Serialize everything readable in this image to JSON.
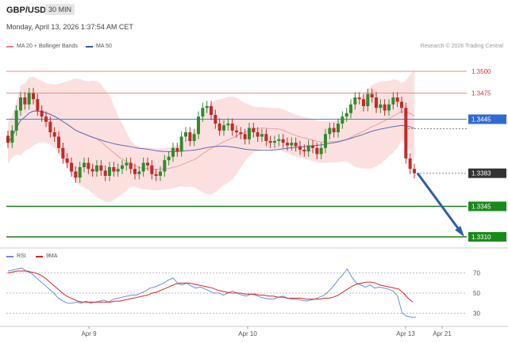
{
  "header": {
    "symbol": "GBP/USD",
    "timeframe": "30 MIN",
    "datetime": "Monday, April 13, 2026 1:37:54 AM CET",
    "credit": "Research © 2026 Trading Central"
  },
  "legend": {
    "bollinger_label": "MA 20 + Bollinger Bands",
    "bollinger_color": "#f08080",
    "ma50_label": "MA 50",
    "ma50_color": "#3a56a8"
  },
  "rsi_legend": {
    "rsi_label": "RSI",
    "rsi_color": "#6a8fd8",
    "ma9_label": "9MA",
    "ma9_color": "#e02020"
  },
  "chart_data": [
    {
      "type": "candlestick",
      "title": "",
      "x_labels": [
        "Apr 9",
        "Apr 10",
        "Apr 13",
        "Apr 21"
      ],
      "ylim": [
        1.33,
        1.352
      ],
      "levels": [
        {
          "value": 1.35,
          "label": "1.3500",
          "style": "red-line",
          "color": "#e03030"
        },
        {
          "value": 1.3475,
          "label": "1.3475",
          "style": "red-line",
          "color": "#e03030"
        },
        {
          "value": 1.3445,
          "label": "1.3445",
          "style": "blue-line",
          "color": "#3b6fd8"
        },
        {
          "value": 1.3383,
          "label": "1.3383",
          "style": "current",
          "color": "#333333"
        },
        {
          "value": 1.3345,
          "label": "1.3345",
          "style": "green-line",
          "color": "#1a8a1a"
        },
        {
          "value": 1.331,
          "label": "1.3310",
          "style": "green-line",
          "color": "#1a8a1a"
        }
      ],
      "forecast_arrow": {
        "from": 1.3383,
        "to": 1.331
      },
      "candles_close": [
        1.3418,
        1.3432,
        1.3455,
        1.347,
        1.3462,
        1.3475,
        1.3468,
        1.3455,
        1.3448,
        1.3442,
        1.343,
        1.3425,
        1.3412,
        1.34,
        1.3395,
        1.3385,
        1.3378,
        1.339,
        1.3395,
        1.3388,
        1.3385,
        1.3392,
        1.3386,
        1.338,
        1.339,
        1.3385,
        1.3388,
        1.3392,
        1.3395,
        1.3388,
        1.3382,
        1.3385,
        1.3395,
        1.3392,
        1.3382,
        1.338,
        1.3385,
        1.3398,
        1.3402,
        1.3412,
        1.3408,
        1.3425,
        1.343,
        1.342,
        1.3428,
        1.3448,
        1.3458,
        1.346,
        1.345,
        1.344,
        1.3432,
        1.3438,
        1.344,
        1.3432,
        1.343,
        1.3428,
        1.3422,
        1.3435,
        1.343,
        1.3425,
        1.3428,
        1.342,
        1.3418,
        1.342,
        1.3422,
        1.3418,
        1.3415,
        1.3418,
        1.3414,
        1.341,
        1.3408,
        1.3415,
        1.3412,
        1.3405,
        1.3412,
        1.3428,
        1.3435,
        1.343,
        1.344,
        1.3448,
        1.3452,
        1.3462,
        1.347,
        1.3468,
        1.346,
        1.3474,
        1.347,
        1.3458,
        1.3462,
        1.3455,
        1.3462,
        1.347,
        1.3465,
        1.3458,
        1.34,
        1.3388,
        1.3383
      ],
      "rsi": {
        "ylim": [
          20,
          80
        ],
        "ticks": [
          70,
          50,
          30
        ],
        "values": [
          72,
          73,
          74,
          75,
          72,
          70,
          66,
          62,
          58,
          54,
          50,
          45,
          42,
          40,
          40,
          41,
          40,
          42,
          40,
          41,
          42,
          43,
          41,
          44,
          45,
          46,
          47,
          48,
          48,
          50,
          52,
          55,
          56,
          58,
          60,
          63,
          65,
          60,
          58,
          60,
          57,
          55,
          56,
          54,
          52,
          50,
          50,
          48,
          50,
          52,
          50,
          48,
          47,
          49,
          48,
          46,
          45,
          44,
          44,
          46,
          47,
          45,
          44,
          44,
          43,
          42,
          43,
          44,
          46,
          48,
          52,
          57,
          63,
          68,
          74,
          66,
          60,
          58,
          56,
          58,
          55,
          56,
          55,
          54,
          52,
          47,
          30,
          27,
          26,
          26
        ],
        "ma9": [
          70,
          71,
          72,
          72,
          72,
          71,
          70,
          68,
          65,
          61,
          57,
          53,
          49,
          46,
          44,
          42,
          41,
          41,
          41,
          41,
          41,
          41,
          41,
          42,
          42,
          43,
          44,
          45,
          46,
          47,
          48,
          50,
          51,
          53,
          55,
          57,
          59,
          60,
          60,
          60,
          59,
          58,
          57,
          56,
          55,
          53,
          52,
          51,
          50,
          50,
          50,
          49,
          49,
          49,
          48,
          48,
          47,
          47,
          46,
          46,
          45,
          45,
          45,
          45,
          44,
          44,
          44,
          44,
          45,
          45,
          46,
          48,
          51,
          54,
          57,
          59,
          60,
          61,
          61,
          60,
          58,
          57,
          56,
          55,
          54,
          50,
          45,
          41
        ]
      }
    }
  ]
}
